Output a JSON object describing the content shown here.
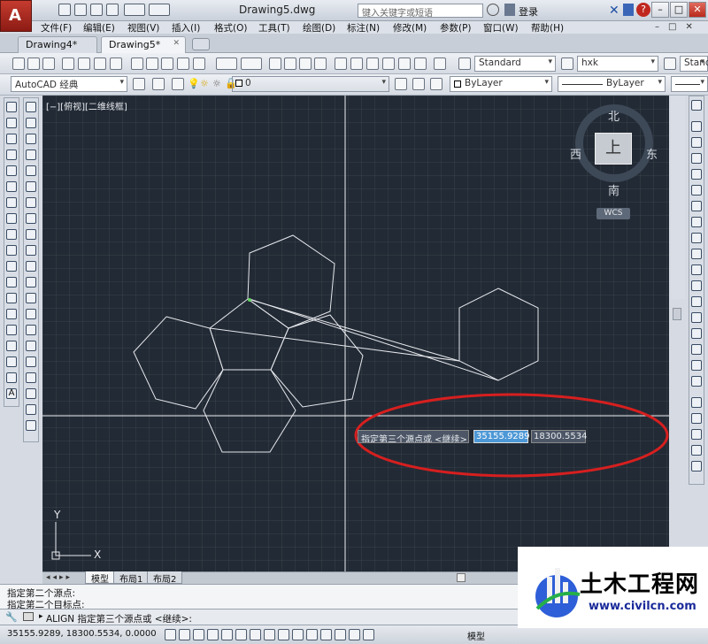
{
  "app": {
    "title": "Drawing5.dwg",
    "logo_letter": "A"
  },
  "search": {
    "placeholder": "键入关键字或短语"
  },
  "login": {
    "label": "登录"
  },
  "menus": [
    "文件(F)",
    "编辑(E)",
    "视图(V)",
    "插入(I)",
    "格式(O)",
    "工具(T)",
    "绘图(D)",
    "标注(N)",
    "修改(M)",
    "参数(P)",
    "窗口(W)",
    "帮助(H)"
  ],
  "tabs": [
    {
      "label": "Drawing4*",
      "active": false
    },
    {
      "label": "Drawing5*",
      "active": true
    }
  ],
  "toolbar": {
    "text_style": "Standard",
    "dim_style": "hxk",
    "table_style": "Stand",
    "workspace": "AutoCAD 经典",
    "layer": "0",
    "color": "ByLayer",
    "linetype": "ByLayer"
  },
  "viewport": {
    "label": "[−][俯视][二维线框]"
  },
  "viewcube": {
    "north": "北",
    "south": "南",
    "east": "东",
    "west": "西",
    "top": "上",
    "wcs": "WCS"
  },
  "ucs": {
    "x": "X",
    "y": "Y"
  },
  "dynamic_input": {
    "prompt": "指定第三个源点或 <继续>:",
    "x_value": "35155.9289",
    "y_value": "18300.5534"
  },
  "layout_tabs": [
    {
      "label": "模型",
      "active": true
    },
    {
      "label": "布局1",
      "active": false
    },
    {
      "label": "布局2",
      "active": false
    }
  ],
  "command_history": [
    "指定第二个源点:",
    "指定第二个目标点:"
  ],
  "command_line": {
    "text": "ALIGN 指定第三个源点或 <继续>:"
  },
  "status": {
    "coords": "35155.9289, 18300.5534, 0.0000",
    "model_label": "模型"
  },
  "watermark": {
    "name": "土木工程网",
    "url": "www.civilcn.com"
  },
  "colors": {
    "canvas": "#222a35",
    "annotation_ellipse": "#d61f1f",
    "geometry": "#e6e8ec"
  }
}
